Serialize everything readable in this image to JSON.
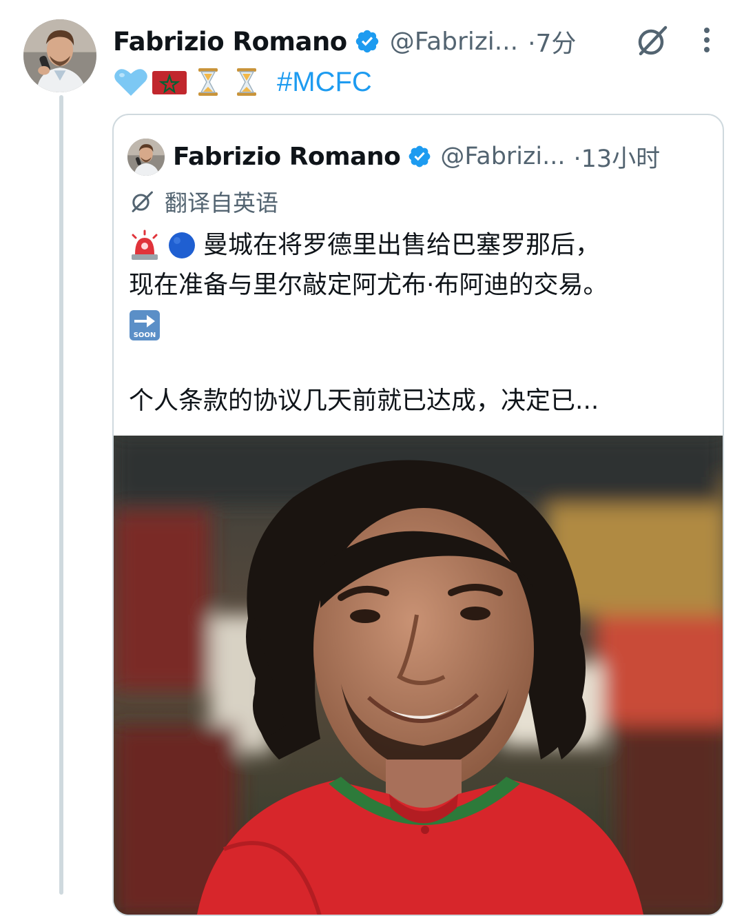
{
  "tweet": {
    "author_name": "Fabrizio Romano",
    "handle": "@Fabrizi...",
    "time": "·7分",
    "emojis": [
      "light-blue-heart",
      "morocco-flag",
      "hourglass",
      "hourglass"
    ],
    "hashtag": "#MCFC"
  },
  "quote": {
    "author_name": "Fabrizio Romano",
    "handle": "@Fabrizi...",
    "time": "·13小时",
    "translate_label": "翻译自英语",
    "line1_emojis": [
      "police-light",
      "blue-circle"
    ],
    "line1": "曼城在将罗德里出售给巴塞罗那后，",
    "line2": "现在准备与里尔敲定阿尤布·布阿迪的交易。",
    "line3_emoji": "soon-arrow",
    "soon_label": "SOON",
    "line4": "个人条款的协议几天前就已达成，决定已..."
  },
  "colors": {
    "accent": "#1d9bf0",
    "secondary_text": "#536471",
    "border": "#cfd9de"
  }
}
